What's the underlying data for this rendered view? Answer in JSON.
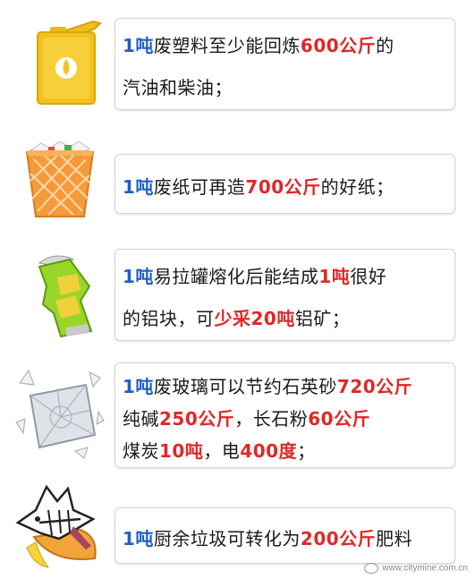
{
  "items": [
    {
      "icon": "oil-can-icon",
      "lines": [
        [
          {
            "t": "1吨",
            "c": "blue"
          },
          {
            "t": "废塑料至少能回炼"
          },
          {
            "t": "600公斤",
            "c": "red"
          },
          {
            "t": "的"
          }
        ],
        [
          {
            "t": "汽油和柴油；"
          }
        ]
      ]
    },
    {
      "icon": "wastebasket-icon",
      "lines": [
        [
          {
            "t": "1吨",
            "c": "blue"
          },
          {
            "t": "废纸可再造"
          },
          {
            "t": "700公斤",
            "c": "red"
          },
          {
            "t": "的好纸；"
          }
        ]
      ]
    },
    {
      "icon": "crushed-can-icon",
      "lines": [
        [
          {
            "t": "1吨",
            "c": "blue"
          },
          {
            "t": "易拉罐熔化后能结成"
          },
          {
            "t": "1吨",
            "c": "red"
          },
          {
            "t": "很好"
          }
        ],
        [
          {
            "t": "的铝块，可"
          },
          {
            "t": "少采20吨",
            "c": "red"
          },
          {
            "t": "铝矿；"
          }
        ]
      ]
    },
    {
      "icon": "broken-glass-icon",
      "lines": [
        [
          {
            "t": "1吨",
            "c": "blue"
          },
          {
            "t": "废玻璃可以节约石英砂"
          },
          {
            "t": "720公斤",
            "c": "red"
          }
        ],
        [
          {
            "t": "纯碱"
          },
          {
            "t": "250公斤",
            "c": "red"
          },
          {
            "t": "，长石粉"
          },
          {
            "t": "60公斤",
            "c": "red"
          }
        ],
        [
          {
            "t": "煤炭"
          },
          {
            "t": "10吨",
            "c": "red"
          },
          {
            "t": "，电"
          },
          {
            "t": "400度",
            "c": "red"
          },
          {
            "t": "；"
          }
        ]
      ]
    },
    {
      "icon": "kitchen-waste-icon",
      "lines": [
        [
          {
            "t": "1吨",
            "c": "blue"
          },
          {
            "t": "厨余垃圾可转化为"
          },
          {
            "t": "200公斤",
            "c": "red"
          },
          {
            "t": "肥料"
          }
        ]
      ]
    }
  ],
  "footer": {
    "text": "www.citymine.com.cn"
  },
  "colors": {
    "blue": "#1f5fc4",
    "red": "#e02727"
  }
}
